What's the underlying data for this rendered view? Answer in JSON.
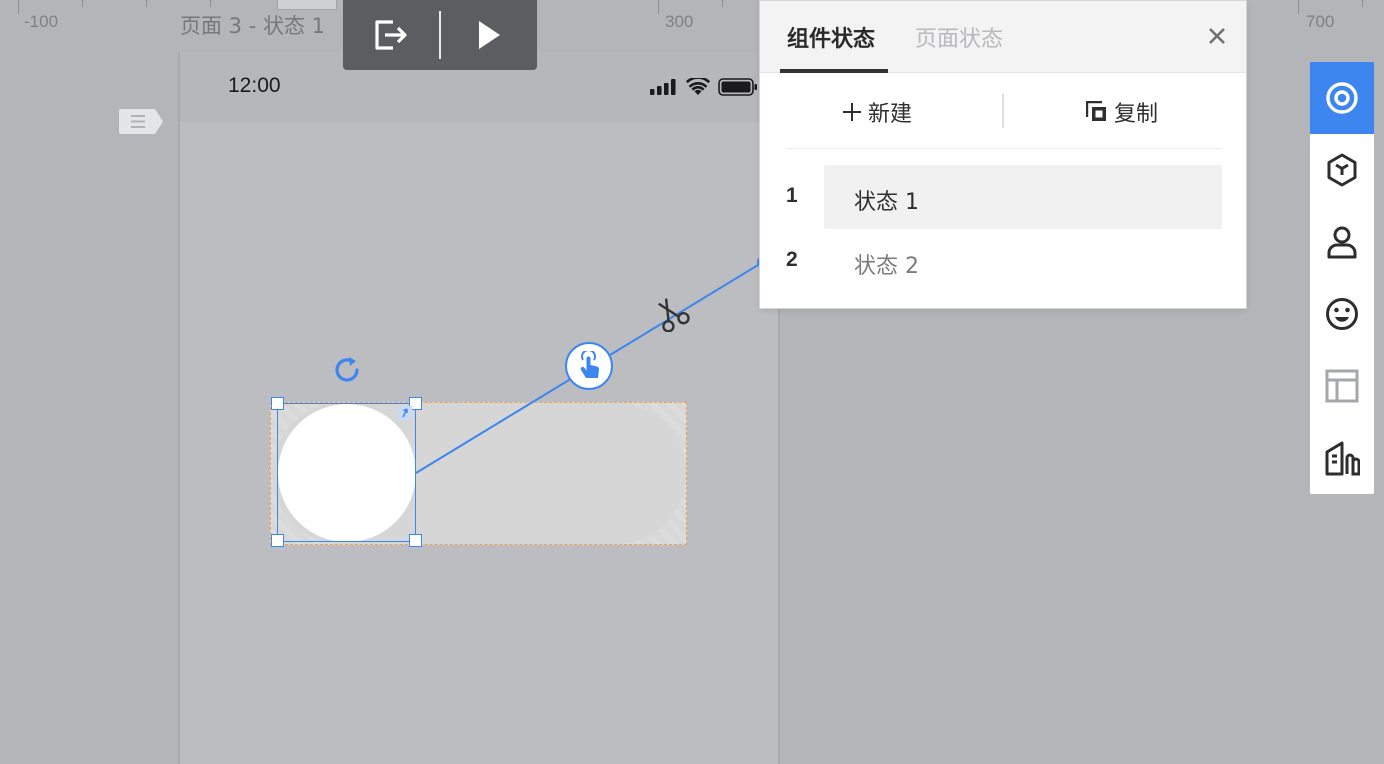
{
  "ruler": {
    "labels": [
      "-100",
      "300",
      "700"
    ]
  },
  "page": {
    "title": "页面 3 - 状态 1"
  },
  "toolbar": {
    "exit_icon": "exit-icon",
    "play_icon": "play-icon"
  },
  "device": {
    "time": "12:00",
    "icons": [
      "signal-icon",
      "wifi-icon",
      "battery-icon"
    ]
  },
  "canvas": {
    "component": "toggle-switch",
    "trigger_icon": "tap-gesture-icon",
    "connection_tool": "scissors-icon",
    "colors": {
      "selection": "#3d86f0",
      "bounds": "#f0a050",
      "track": "#d6d6d7",
      "knob": "#ffffff"
    }
  },
  "panel": {
    "tabs": [
      {
        "label": "组件状态",
        "active": true
      },
      {
        "label": "页面状态",
        "active": false
      }
    ],
    "close_icon": "close-icon",
    "actions": {
      "new_label": "新建",
      "copy_label": "复制"
    },
    "states": [
      {
        "index": "1",
        "label": "状态 1",
        "selected": true
      },
      {
        "index": "2",
        "label": "状态 2",
        "selected": false
      }
    ]
  },
  "right_toolbar": {
    "items": [
      {
        "icon": "target-icon",
        "active": true
      },
      {
        "icon": "component-cube-icon",
        "active": false
      },
      {
        "icon": "user-icon",
        "active": false
      },
      {
        "icon": "emoji-icon",
        "active": false
      },
      {
        "icon": "layout-icon",
        "active": false
      },
      {
        "icon": "chart-buildings-icon",
        "active": false
      }
    ],
    "accent": "#3d86f0"
  }
}
